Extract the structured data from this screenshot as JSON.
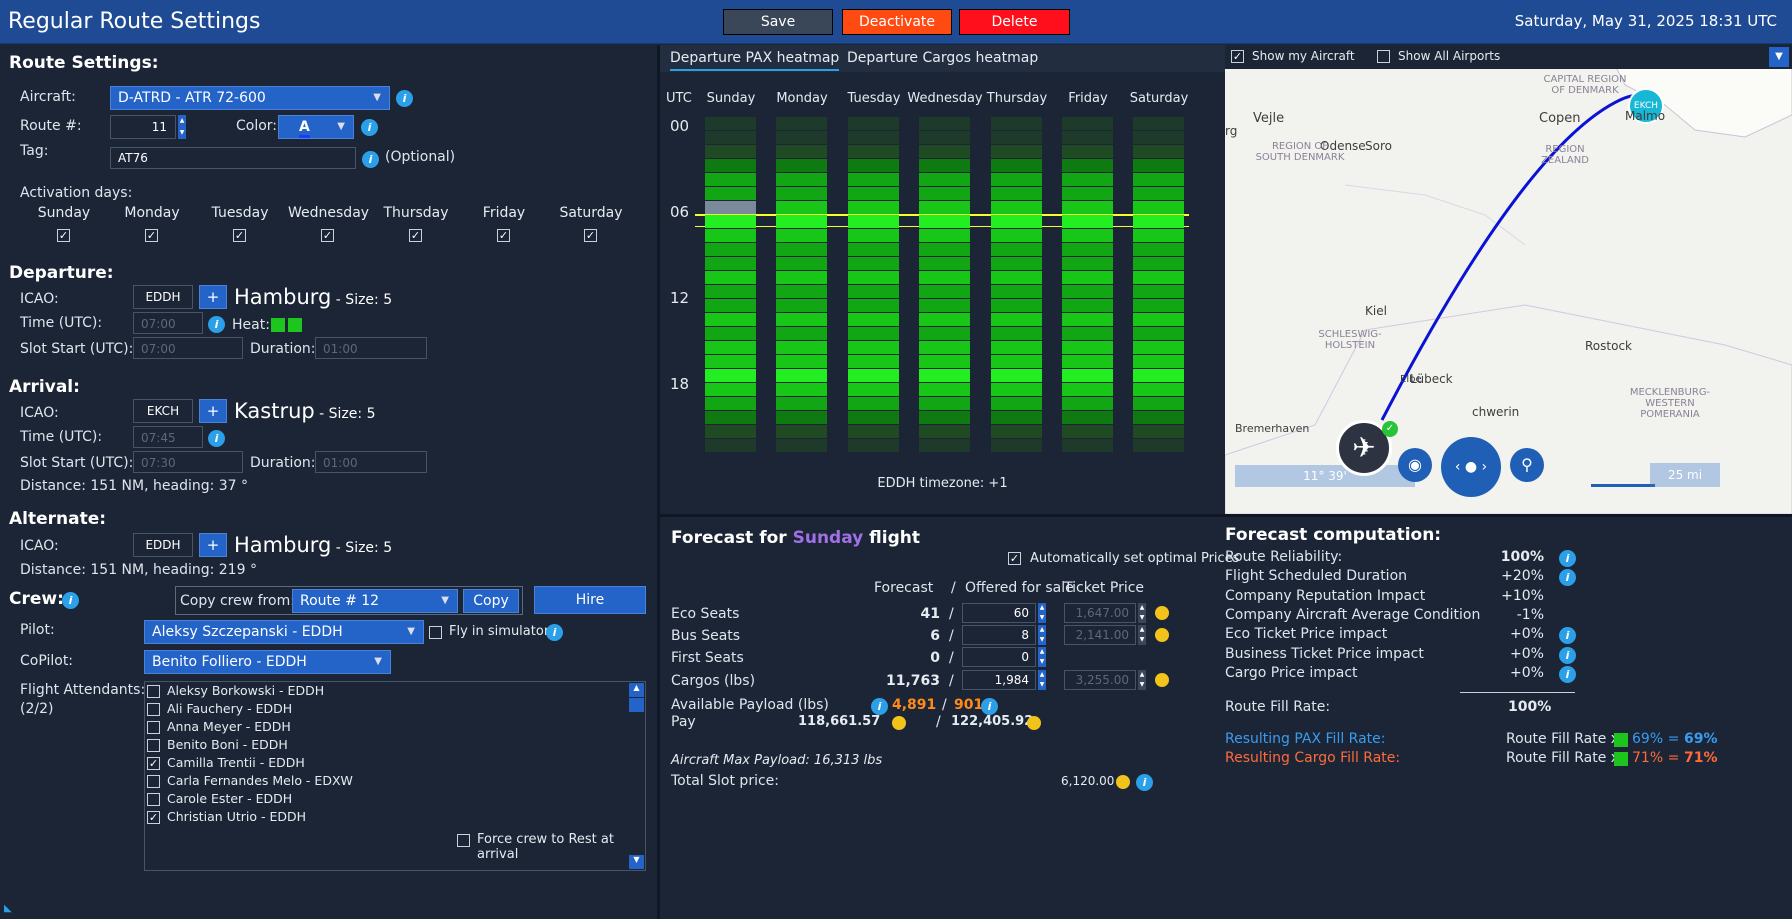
{
  "header": {
    "title": "Regular Route Settings",
    "save": "Save",
    "deactivate": "Deactivate",
    "delete": "Delete",
    "datetime": "Saturday, May 31, 2025 18:31 UTC"
  },
  "route": {
    "heading": "Route Settings:",
    "aircraft_label": "Aircraft:",
    "aircraft": "D-ATRD - ATR 72-600",
    "route_label": "Route #:",
    "route_num": "11",
    "color_label": "Color:",
    "color_char": "A",
    "tag_label": "Tag:",
    "tag": "AT76",
    "optional": "(Optional)",
    "activation_label": "Activation days:",
    "days": [
      "Sunday",
      "Monday",
      "Tuesday",
      "Wednesday",
      "Thursday",
      "Friday",
      "Saturday"
    ]
  },
  "departure": {
    "heading": "Departure:",
    "icao_label": "ICAO:",
    "icao": "EDDH",
    "plus": "+",
    "city": "Hamburg",
    "size": " - Size: 5",
    "time_label": "Time (UTC):",
    "time": "07:00",
    "heat_label": "Heat:",
    "slot_label": "Slot Start (UTC):",
    "slot": "07:00",
    "dur_label": "Duration:",
    "dur": "01:00"
  },
  "arrival": {
    "heading": "Arrival:",
    "icao_label": "ICAO:",
    "icao": "EKCH",
    "plus": "+",
    "city": "Kastrup",
    "size": " - Size: 5",
    "time_label": "Time (UTC):",
    "time": "07:45",
    "slot_label": "Slot Start (UTC):",
    "slot": "07:30",
    "dur_label": "Duration:",
    "dur": "01:00",
    "distance": "Distance: 151 NM, heading: 37 °"
  },
  "alternate": {
    "heading": "Alternate:",
    "icao_label": "ICAO:",
    "icao": "EDDH",
    "plus": "+",
    "city": "Hamburg",
    "size": " - Size: 5",
    "distance": "Distance: 151 NM, heading: 219 °"
  },
  "crew": {
    "heading": "Crew:",
    "copy_from": "Copy crew from:",
    "copy_route": "Route # 12",
    "copy": "Copy",
    "hire": "Hire",
    "pilot_label": "Pilot:",
    "pilot": "Aleksy Szczepanski - EDDH",
    "fly_sim": "Fly in simulator",
    "copilot_label": "CoPilot:",
    "copilot": "Benito Folliero - EDDH",
    "fa_label": "Flight Attendants:",
    "fa_count": "(2/2)",
    "attendants": [
      "Aleksy Borkowski - EDDH",
      "Ali Fauchery - EDDH",
      "Anna Meyer - EDDH",
      "Benito Boni - EDDH",
      "Camilla Trentii - EDDH",
      "Carla Fernandes Melo - EDXW",
      "Carole Ester - EDDH",
      "Christian Utrio - EDDH"
    ],
    "attendants_checked": [
      false,
      false,
      false,
      false,
      true,
      false,
      false,
      true
    ],
    "force_rest": "Force crew to Rest at arrival"
  },
  "heatmap": {
    "tab_pax": "Departure PAX heatmap",
    "tab_cargo": "Departure Cargos heatmap",
    "utc": "UTC",
    "hours": [
      "00",
      "06",
      "12",
      "18"
    ],
    "days": [
      "Sunday",
      "Monday",
      "Tuesday",
      "Wednesday",
      "Thursday",
      "Friday",
      "Saturday"
    ],
    "timezone": "EDDH timezone: +1"
  },
  "map": {
    "show_aircraft": "Show my Aircraft",
    "show_airports": "Show All Airports",
    "labels": [
      "Vejle",
      "Odense",
      "Soro",
      "Copen",
      "Malmo",
      "REGION OF SOUTH DENMARK",
      "CAPITAL REGION OF DENMARK",
      "REGION ZEALAND",
      "Kiel",
      "SCHLESWIG-HOLSTEIN",
      "Rostock",
      "Lübeck",
      "MECKLENBURG-WESTERN POMERANIA",
      "Bremerhaven",
      "chwerin",
      "rg",
      "Elbe"
    ],
    "airport_badge": "EKCH",
    "coords": "11° 39'",
    "scale": "25 mi"
  },
  "forecast": {
    "title_pre": "Forecast for ",
    "title_day": "Sunday",
    "title_post": " flight",
    "auto": "Automatically set optimal Prices",
    "col_forecast": "Forecast",
    "col_sep": "/",
    "col_offered": "Offered for sale",
    "col_price": "Ticket Price",
    "rows": [
      {
        "label": "Eco Seats",
        "forecast": "41",
        "offered": "60",
        "price": "1,647.00"
      },
      {
        "label": "Bus Seats",
        "forecast": "6",
        "offered": "8",
        "price": "2,141.00"
      },
      {
        "label": "First Seats",
        "forecast": "0",
        "offered": "0",
        "price": ""
      },
      {
        "label": "Cargos (lbs)",
        "forecast": "11,763",
        "offered": "1,984",
        "price": "3,255.00"
      }
    ],
    "payload_label": "Available Payload (lbs)",
    "payload_a": "4,891",
    "payload_sep": "/",
    "payload_b": "901",
    "pay_label": "Pay",
    "pay_a": "118,661.57",
    "pay_b": "122,405.92",
    "max_payload": "Aircraft Max Payload: 16,313 lbs",
    "slot_label": "Total Slot price:",
    "slot_price": "6,120.00"
  },
  "computation": {
    "title": "Forecast computation:",
    "rows": [
      {
        "label": "Route Reliability:",
        "value": "100%"
      },
      {
        "label": "Flight Scheduled Duration",
        "value": "+20%"
      },
      {
        "label": "Company Reputation Impact",
        "value": "+10%"
      },
      {
        "label": "Company Aircraft Average Condition",
        "value": "-1%"
      },
      {
        "label": "Eco Ticket Price impact",
        "value": "+0%"
      },
      {
        "label": "Business Ticket Price impact",
        "value": "+0%"
      },
      {
        "label": "Cargo Price impact",
        "value": "+0%"
      }
    ],
    "fill_label": "Route Fill Rate:",
    "fill_value": "100%",
    "pax_label": "Resulting PAX Fill Rate:",
    "pax_calc": "Route Fill Rate x",
    "pax_pct": "69% =",
    "pax_result": "69%",
    "cargo_label": "Resulting Cargo Fill Rate:",
    "cargo_calc": "Route Fill Rate x",
    "cargo_pct": "71% =",
    "cargo_result": "71%"
  },
  "colors": {
    "accent": "#2463c8",
    "brand": "#1f4b95",
    "pax": "#3a9cf0",
    "cargo": "#ff6b3a",
    "gold": "#f2c41b",
    "route_line": "#0a12d4"
  }
}
